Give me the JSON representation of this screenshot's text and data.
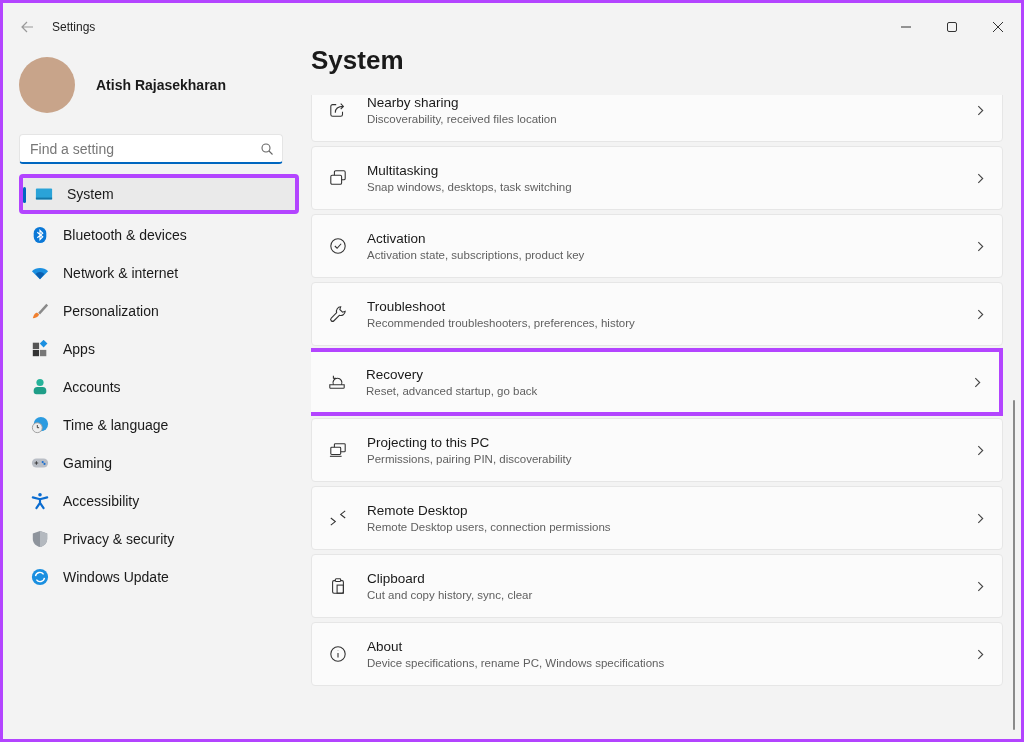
{
  "window": {
    "title": "Settings"
  },
  "user": {
    "name": "Atish Rajasekharan"
  },
  "search": {
    "placeholder": "Find a setting"
  },
  "sidebar": {
    "items": [
      {
        "label": "System",
        "selected": true,
        "highlighted": true
      },
      {
        "label": "Bluetooth & devices",
        "selected": false,
        "highlighted": false
      },
      {
        "label": "Network & internet",
        "selected": false,
        "highlighted": false
      },
      {
        "label": "Personalization",
        "selected": false,
        "highlighted": false
      },
      {
        "label": "Apps",
        "selected": false,
        "highlighted": false
      },
      {
        "label": "Accounts",
        "selected": false,
        "highlighted": false
      },
      {
        "label": "Time & language",
        "selected": false,
        "highlighted": false
      },
      {
        "label": "Gaming",
        "selected": false,
        "highlighted": false
      },
      {
        "label": "Accessibility",
        "selected": false,
        "highlighted": false
      },
      {
        "label": "Privacy & security",
        "selected": false,
        "highlighted": false
      },
      {
        "label": "Windows Update",
        "selected": false,
        "highlighted": false
      }
    ]
  },
  "page": {
    "title": "System",
    "items": [
      {
        "title": "Nearby sharing",
        "subtitle": "Discoverability, received files location",
        "highlighted": false
      },
      {
        "title": "Multitasking",
        "subtitle": "Snap windows, desktops, task switching",
        "highlighted": false
      },
      {
        "title": "Activation",
        "subtitle": "Activation state, subscriptions, product key",
        "highlighted": false
      },
      {
        "title": "Troubleshoot",
        "subtitle": "Recommended troubleshooters, preferences, history",
        "highlighted": false
      },
      {
        "title": "Recovery",
        "subtitle": "Reset, advanced startup, go back",
        "highlighted": true
      },
      {
        "title": "Projecting to this PC",
        "subtitle": "Permissions, pairing PIN, discoverability",
        "highlighted": false
      },
      {
        "title": "Remote Desktop",
        "subtitle": "Remote Desktop users, connection permissions",
        "highlighted": false
      },
      {
        "title": "Clipboard",
        "subtitle": "Cut and copy history, sync, clear",
        "highlighted": false
      },
      {
        "title": "About",
        "subtitle": "Device specifications, rename PC, Windows specifications",
        "highlighted": false
      }
    ]
  }
}
